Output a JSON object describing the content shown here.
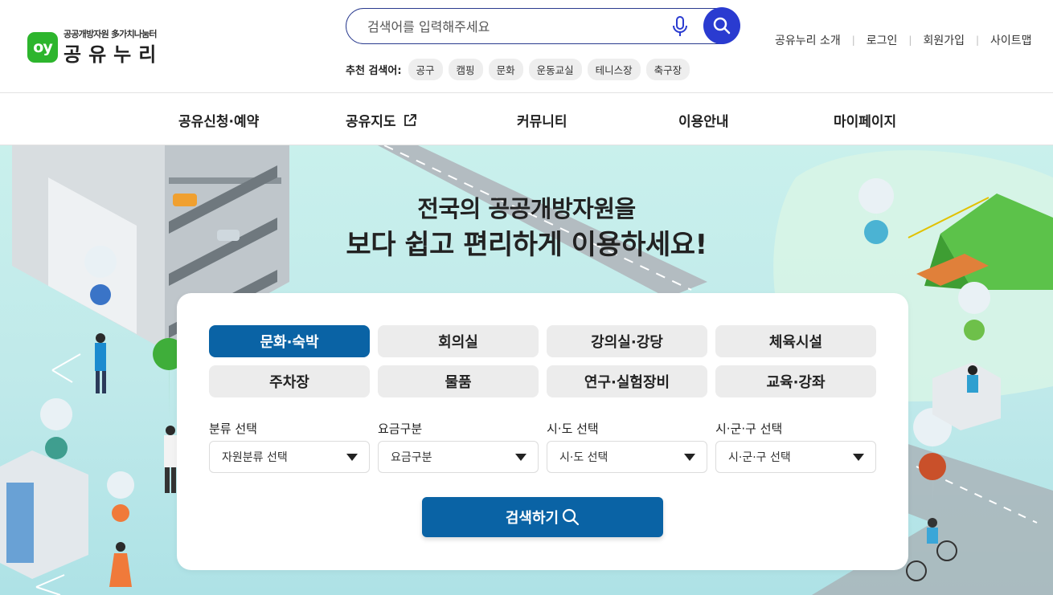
{
  "logo": {
    "badge": "oy",
    "subtitle": "공공개방자원 多가치나눔터",
    "title": "공유누리"
  },
  "search": {
    "placeholder": "검색어를 입력해주세요",
    "value": ""
  },
  "recommend": {
    "label": "추천 검색어:",
    "keywords": [
      "공구",
      "캠핑",
      "문화",
      "운동교실",
      "테니스장",
      "축구장"
    ]
  },
  "util_links": [
    "공유누리 소개",
    "로그인",
    "회원가입",
    "사이트맵"
  ],
  "gnb": [
    "공유신청·예약",
    "공유지도",
    "커뮤니티",
    "이용안내",
    "마이페이지"
  ],
  "hero": {
    "line1": "전국의 공공개방자원을",
    "line2": "보다 쉽고 편리하게 이용하세요!"
  },
  "categories": [
    {
      "label": "문화·숙박",
      "active": true
    },
    {
      "label": "회의실",
      "active": false
    },
    {
      "label": "강의실·강당",
      "active": false
    },
    {
      "label": "체육시설",
      "active": false
    },
    {
      "label": "주차장",
      "active": false
    },
    {
      "label": "물품",
      "active": false
    },
    {
      "label": "연구·실험장비",
      "active": false
    },
    {
      "label": "교육·강좌",
      "active": false
    }
  ],
  "filters": [
    {
      "label": "분류 선택",
      "value": "자원분류 선택"
    },
    {
      "label": "요금구분",
      "value": "요금구분"
    },
    {
      "label": "시·도 선택",
      "value": "시·도 선택"
    },
    {
      "label": "시·군·구 선택",
      "value": "시·군·구 선택"
    }
  ],
  "submit_label": "검색하기",
  "colors": {
    "primary": "#0a63a5",
    "search_button": "#2a3bd0",
    "logo_green": "#2db52d",
    "hero_bg": "#c9f0ec"
  }
}
